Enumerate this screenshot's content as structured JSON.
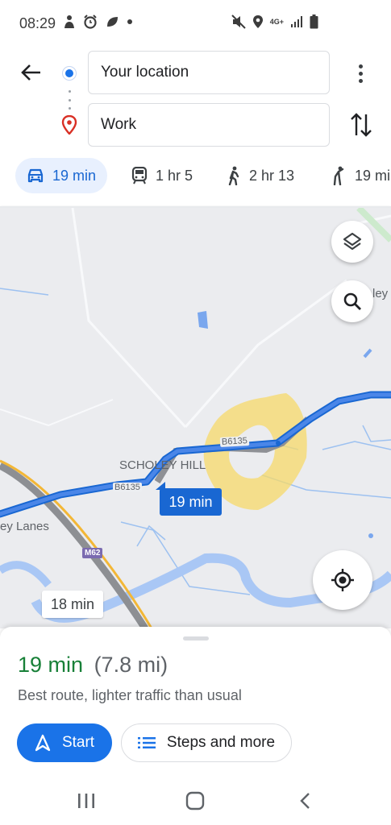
{
  "status_bar": {
    "time": "08:29",
    "network": "4G+",
    "left_icons": [
      "person-icon",
      "alarm-icon",
      "leaf-icon",
      "dot-icon"
    ],
    "right_icons": [
      "mute-icon",
      "location-icon",
      "network-icon",
      "signal-icon",
      "battery-icon"
    ]
  },
  "directions": {
    "origin": "Your location",
    "destination": "Work"
  },
  "modes": [
    {
      "name": "drive",
      "label": "19 min",
      "icon": "car-icon",
      "active": true
    },
    {
      "name": "transit",
      "label": "1 hr 5",
      "icon": "train-icon",
      "active": false
    },
    {
      "name": "walk",
      "label": "2 hr 13",
      "icon": "walk-icon",
      "active": false
    },
    {
      "name": "ride",
      "label": "19 mi",
      "icon": "person-hail-icon",
      "active": false
    }
  ],
  "map": {
    "place_label": "SCHOLEY HILL",
    "partial_label_left": "ey Lanes",
    "partial_label_right": "ley",
    "road_labels": [
      "B6135",
      "B6135"
    ],
    "motorway_label": "M62",
    "primary_route_time": "19 min",
    "alt_route_time": "18 min"
  },
  "sheet": {
    "duration": "19 min",
    "distance": "(7.8 mi)",
    "description": "Best route, lighter traffic than usual",
    "start_label": "Start",
    "steps_label": "Steps and more"
  },
  "colors": {
    "accent": "#1a73e8",
    "duration_green": "#188038",
    "route_blue": "#4a86e8",
    "traffic_yellow": "#f6d56a"
  }
}
